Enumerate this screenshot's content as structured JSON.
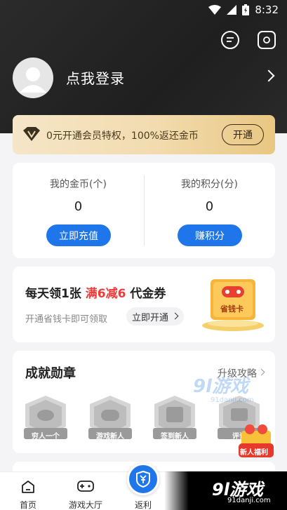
{
  "status_bar": {
    "time": "8:32"
  },
  "header": {
    "login_text": "点我登录"
  },
  "vip_bar": {
    "text": "0元开通会员特权，100%返还金币",
    "button": "开通"
  },
  "coins": {
    "gold_label": "我的金币(个)",
    "gold_value": "0",
    "gold_button": "立即充值",
    "points_label": "我的积分(分)",
    "points_value": "0",
    "points_button": "赚积分"
  },
  "coupon": {
    "title_prefix": "每天领1张 ",
    "title_highlight": "满6减6",
    "title_suffix": " 代金券",
    "subtitle": "开通省钱卡即可领取",
    "button": "立即开通",
    "card_text": "省钱卡"
  },
  "achievements": {
    "title": "成就勋章",
    "more": "升级攻略",
    "badges": [
      "穷人一个",
      "游戏新人",
      "签到新人",
      "评论"
    ]
  },
  "float_gift": "新人福利",
  "watermark": {
    "text": "9l游戏",
    "url": "91danji.com"
  },
  "bottom_nav": {
    "items": [
      "首页",
      "游戏大厅",
      "返利"
    ]
  },
  "brand": {
    "text": "9l游戏",
    "url": "91danji.com"
  },
  "colors": {
    "accent": "#1f76ea",
    "highlight_red": "#f03a3a",
    "vip_gold": "#f2dbae"
  }
}
